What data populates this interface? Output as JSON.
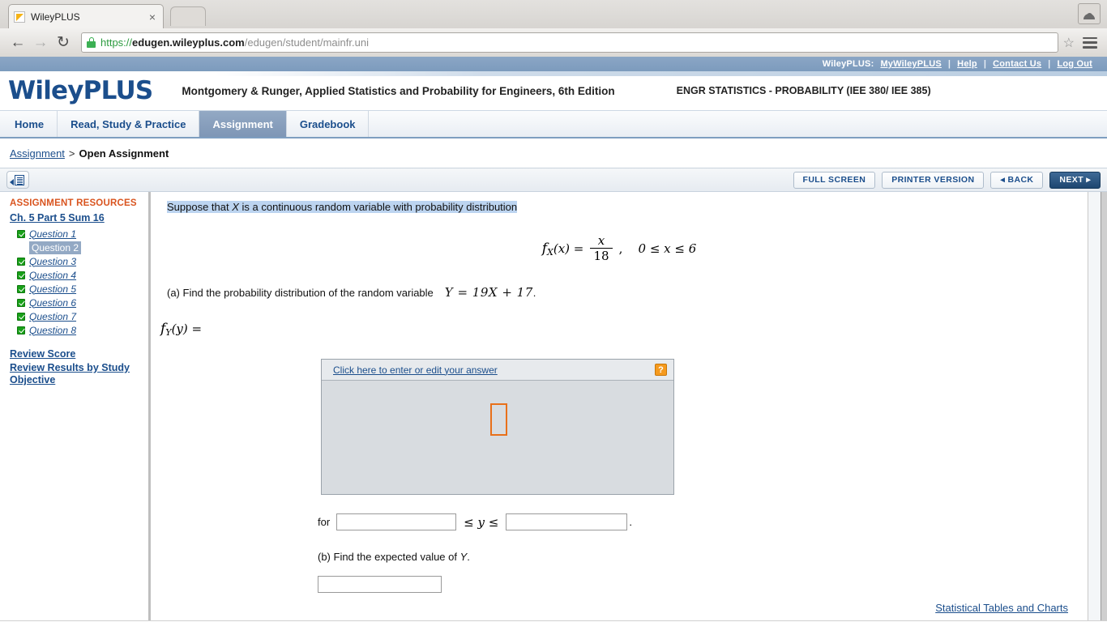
{
  "browser": {
    "tab_title": "WileyPLUS",
    "tab_close": "×",
    "back_icon": "←",
    "forward_icon": "→",
    "reload_icon": "↻",
    "url_scheme": "https://",
    "url_domain": "edugen.wileyplus.com",
    "url_path": "/edugen/student/mainfr.uni",
    "star_icon": "☆"
  },
  "topbar": {
    "label": "WileyPLUS:",
    "links": [
      "MyWileyPLUS",
      "Help",
      "Contact Us",
      "Log Out"
    ],
    "separator": "|"
  },
  "header": {
    "logo": "WileyPLUS",
    "course_title": "Montgomery & Runger, Applied Statistics and Probability for Engineers, 6th Edition",
    "section_title": "ENGR STATISTICS - PROBABILITY (IEE 380/ IEE 385)"
  },
  "nav_tabs": [
    {
      "label": "Home",
      "active": false
    },
    {
      "label": "Read, Study & Practice",
      "active": false
    },
    {
      "label": "Assignment",
      "active": true
    },
    {
      "label": "Gradebook",
      "active": false
    }
  ],
  "breadcrumb": {
    "root": "Assignment",
    "separator": ">",
    "current": "Open Assignment"
  },
  "toolbar": {
    "panel_toggle_name": "collapse-resources-panel",
    "full_screen": "FULL SCREEN",
    "printer_version": "PRINTER VERSION",
    "back": "◂ BACK",
    "next": "NEXT ▸"
  },
  "sidebar": {
    "title": "ASSIGNMENT RESOURCES",
    "chapter": "Ch. 5 Part 5 Sum 16",
    "questions": [
      {
        "label": "Question 1",
        "completed": true,
        "current": false
      },
      {
        "label": "Question 2",
        "completed": false,
        "current": true
      },
      {
        "label": "Question 3",
        "completed": true,
        "current": false
      },
      {
        "label": "Question 4",
        "completed": true,
        "current": false
      },
      {
        "label": "Question 5",
        "completed": true,
        "current": false
      },
      {
        "label": "Question 6",
        "completed": true,
        "current": false
      },
      {
        "label": "Question 7",
        "completed": true,
        "current": false
      },
      {
        "label": "Question 8",
        "completed": true,
        "current": false
      }
    ],
    "links": [
      "Review Score",
      "Review Results by Study Objective"
    ]
  },
  "question": {
    "stem_pre": "Suppose that ",
    "stem_var": "X",
    "stem_post": " is a continuous random variable with probability distribution",
    "formula": {
      "fx_f": "f",
      "fx_sub": "X",
      "fx_arg": "(x) =",
      "numerator": "x",
      "denominator": "18",
      "comma": ",",
      "domain": "0 ≤ x ≤ 6"
    },
    "part_a": {
      "text": "(a) Find the probability distribution of the random variable",
      "expression": "Y = 19X + 17",
      "period": "."
    },
    "fy": {
      "f": "f",
      "sub": "Y",
      "arg": "(y) ="
    },
    "answer_editor": {
      "link": "Click here to enter or edit your answer",
      "help_icon": "?",
      "caret_placeholder": ""
    },
    "range": {
      "for_label": "for",
      "lower_value": "",
      "operator": "≤ y ≤",
      "upper_value": "",
      "period": "."
    },
    "part_b": {
      "text_pre": "(b) Find the expected value of ",
      "text_var": "Y",
      "text_post": ".",
      "answer_value": ""
    }
  },
  "footer": {
    "stat_link": "Statistical Tables and Charts"
  }
}
